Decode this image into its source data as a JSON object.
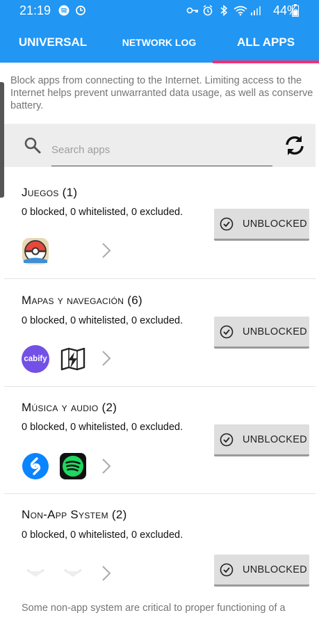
{
  "status_bar": {
    "time": "21:19",
    "battery": "44%"
  },
  "tabs": [
    {
      "label": "UNIVERSAL"
    },
    {
      "label": "NETWORK LOG"
    },
    {
      "label": "ALL APPS"
    }
  ],
  "intro_text": "Block apps from connecting to the Internet. Limiting access to the Internet helps prevent unwarranted data usage, as well as conserve battery.",
  "search": {
    "placeholder": "Search apps"
  },
  "categories": [
    {
      "title": "Juegos (1)",
      "stats": "0 blocked, 0 whitelisted, 0 excluded.",
      "button": "UNBLOCKED"
    },
    {
      "title": "Mapas y navegación (6)",
      "stats": "0 blocked, 0 whitelisted, 0 excluded.",
      "button": "UNBLOCKED",
      "cabify_label": "cabify"
    },
    {
      "title": "Música y audio (2)",
      "stats": "0 blocked, 0 whitelisted, 0 excluded.",
      "button": "UNBLOCKED"
    },
    {
      "title": "Non-App System (2)",
      "stats": "0 blocked, 0 whitelisted, 0 excluded.",
      "button": "UNBLOCKED"
    }
  ],
  "footnote": "Some non-app system are critical to proper functioning of a",
  "colors": {
    "primary": "#2196f3",
    "tab_indicator": "#ff2d6e",
    "button_bg": "#dedede"
  }
}
